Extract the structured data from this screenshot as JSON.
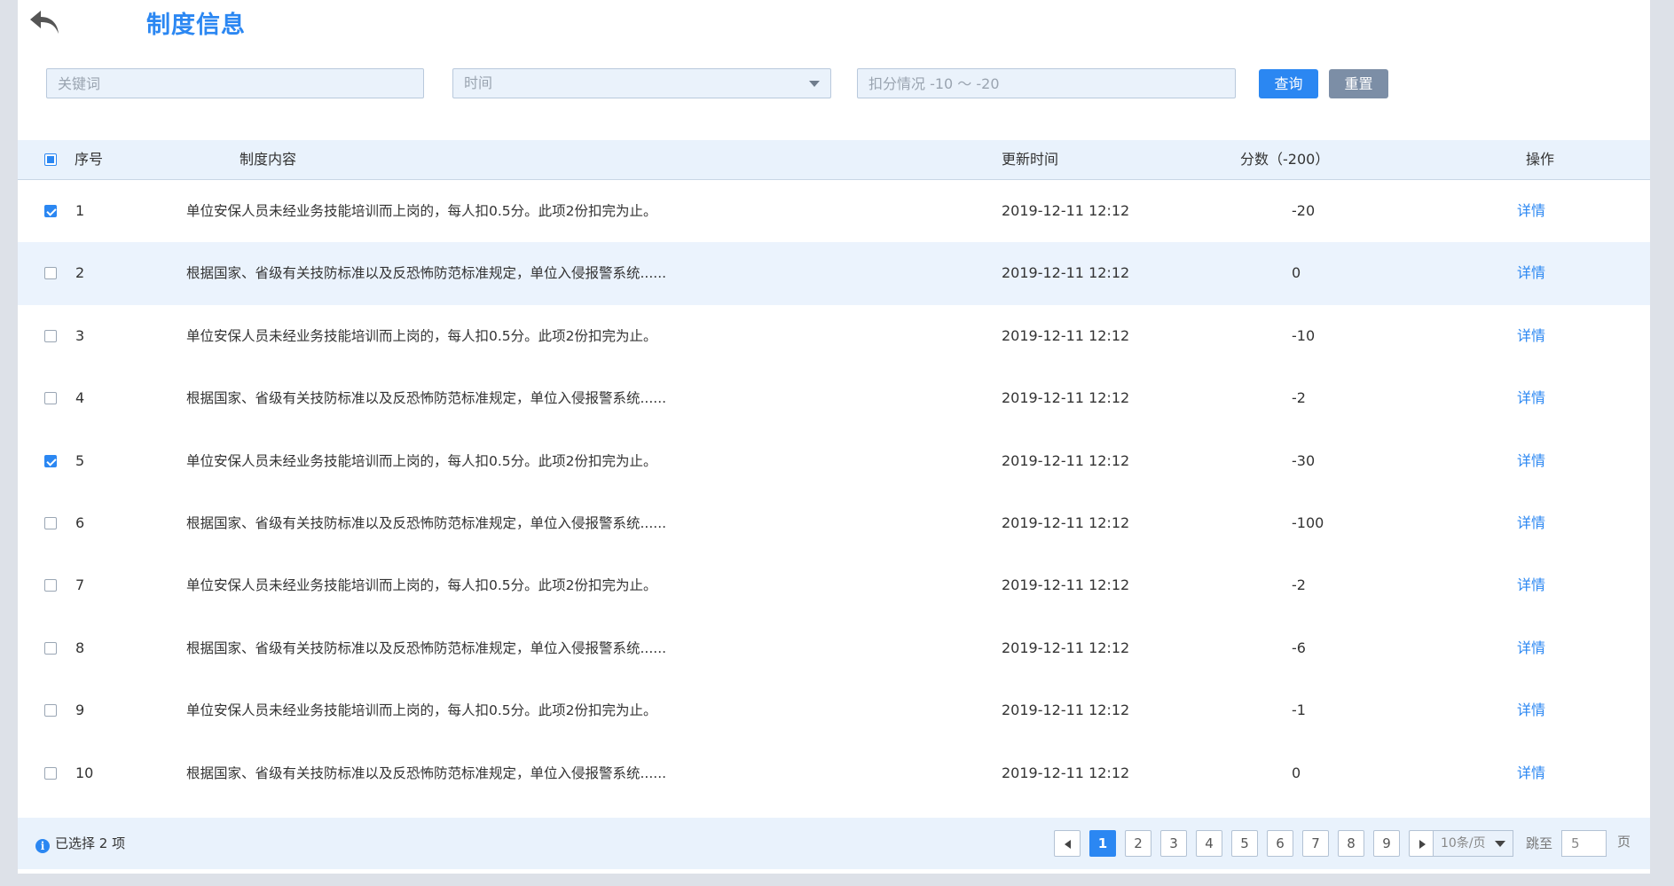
{
  "header": {
    "back_icon": "undo-arrow-icon",
    "title": "制度信息"
  },
  "filters": {
    "keyword_placeholder": "关键词",
    "time_placeholder": "时间",
    "deduct_placeholder": "扣分情况 -10 ～ -20",
    "query_label": "查询",
    "reset_label": "重置"
  },
  "table": {
    "headers": {
      "index": "序号",
      "content": "制度内容",
      "time": "更新时间",
      "score": "分数（-200）",
      "op": "操作"
    },
    "rows": [
      {
        "checked": true,
        "index": "1",
        "content": "单位安保人员未经业务技能培训而上岗的，每人扣0.5分。此项2份扣完为止。",
        "time": "2019-12-11 12:12",
        "score": "-20",
        "op": "详情"
      },
      {
        "checked": false,
        "index": "2",
        "content": "根据国家、省级有关技防标准以及反恐怖防范标准规定，单位入侵报警系统......",
        "time": "2019-12-11 12:12",
        "score": "0",
        "op": "详情"
      },
      {
        "checked": false,
        "index": "3",
        "content": "单位安保人员未经业务技能培训而上岗的，每人扣0.5分。此项2份扣完为止。",
        "time": "2019-12-11 12:12",
        "score": "-10",
        "op": "详情"
      },
      {
        "checked": false,
        "index": "4",
        "content": "根据国家、省级有关技防标准以及反恐怖防范标准规定，单位入侵报警系统......",
        "time": "2019-12-11 12:12",
        "score": "-2",
        "op": "详情"
      },
      {
        "checked": true,
        "index": "5",
        "content": "单位安保人员未经业务技能培训而上岗的，每人扣0.5分。此项2份扣完为止。",
        "time": "2019-12-11 12:12",
        "score": "-30",
        "op": "详情"
      },
      {
        "checked": false,
        "index": "6",
        "content": "根据国家、省级有关技防标准以及反恐怖防范标准规定，单位入侵报警系统......",
        "time": "2019-12-11 12:12",
        "score": "-100",
        "op": "详情"
      },
      {
        "checked": false,
        "index": "7",
        "content": "单位安保人员未经业务技能培训而上岗的，每人扣0.5分。此项2份扣完为止。",
        "time": "2019-12-11 12:12",
        "score": "-2",
        "op": "详情"
      },
      {
        "checked": false,
        "index": "8",
        "content": "根据国家、省级有关技防标准以及反恐怖防范标准规定，单位入侵报警系统......",
        "time": "2019-12-11 12:12",
        "score": "-6",
        "op": "详情"
      },
      {
        "checked": false,
        "index": "9",
        "content": "单位安保人员未经业务技能培训而上岗的，每人扣0.5分。此项2份扣完为止。",
        "time": "2019-12-11 12:12",
        "score": "-1",
        "op": "详情"
      },
      {
        "checked": false,
        "index": "10",
        "content": "根据国家、省级有关技防标准以及反恐怖防范标准规定，单位入侵报警系统......",
        "time": "2019-12-11 12:12",
        "score": "0",
        "op": "详情"
      }
    ]
  },
  "footer": {
    "selected_text": "已选择 2 项",
    "pages": [
      "1",
      "2",
      "3",
      "4",
      "5",
      "6",
      "7",
      "8",
      "9"
    ],
    "current_page": "1",
    "page_size": "10条/页",
    "jump_label": "跳至",
    "jump_value": "5",
    "jump_unit": "页"
  },
  "colors": {
    "accent": "#2b87f2",
    "reset_button": "#7c8ea6",
    "header_bg": "#e9f2fc",
    "alt_row_bg": "#ebf3fd"
  }
}
